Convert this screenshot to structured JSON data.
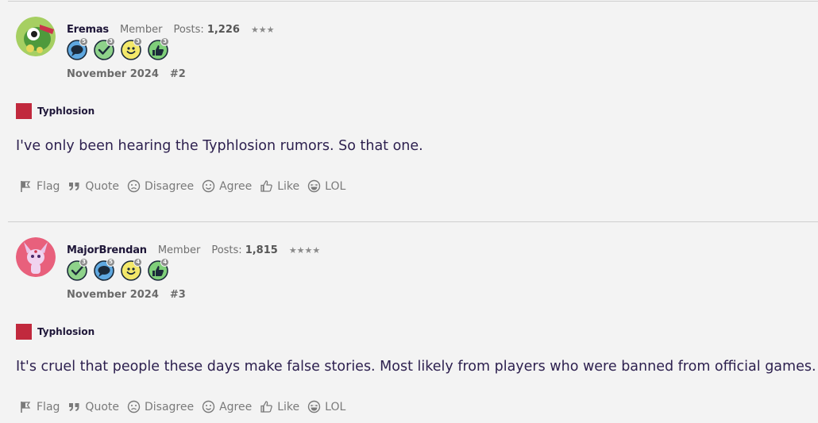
{
  "posts": [
    {
      "username": "Eremas",
      "role": "Member",
      "posts_label": "Posts:",
      "posts_count": "1,226",
      "stars": "★★★",
      "badges": [
        {
          "icon": "comment-badge-icon",
          "level": "5"
        },
        {
          "icon": "check-badge-icon",
          "level": "3"
        },
        {
          "icon": "smile-badge-icon",
          "level": "3"
        },
        {
          "icon": "thumbs-up-badge-icon",
          "level": "3"
        }
      ],
      "date": "November 2024",
      "permalink": "#2",
      "category": "Typhlosion",
      "body": "I've only been hearing the Typhlosion rumors. So that one."
    },
    {
      "username": "MajorBrendan",
      "role": "Member",
      "posts_label": "Posts:",
      "posts_count": "1,815",
      "stars": "★★★★",
      "badges": [
        {
          "icon": "check-badge-icon",
          "level": "3"
        },
        {
          "icon": "comment-badge-icon",
          "level": "5"
        },
        {
          "icon": "smile-badge-icon",
          "level": "4"
        },
        {
          "icon": "thumbs-up-badge-icon",
          "level": "4"
        }
      ],
      "date": "November 2024",
      "permalink": "#3",
      "category": "Typhlosion",
      "body": "It's cruel that people these days make false stories. Most likely from players who were banned from official games."
    }
  ],
  "reactions": [
    "Flag",
    "Quote",
    "Disagree",
    "Agree",
    "Like",
    "LOL"
  ],
  "colors": {
    "category": "#c1293d",
    "text": "#2c1f4e",
    "muted": "#7a7a7a"
  }
}
